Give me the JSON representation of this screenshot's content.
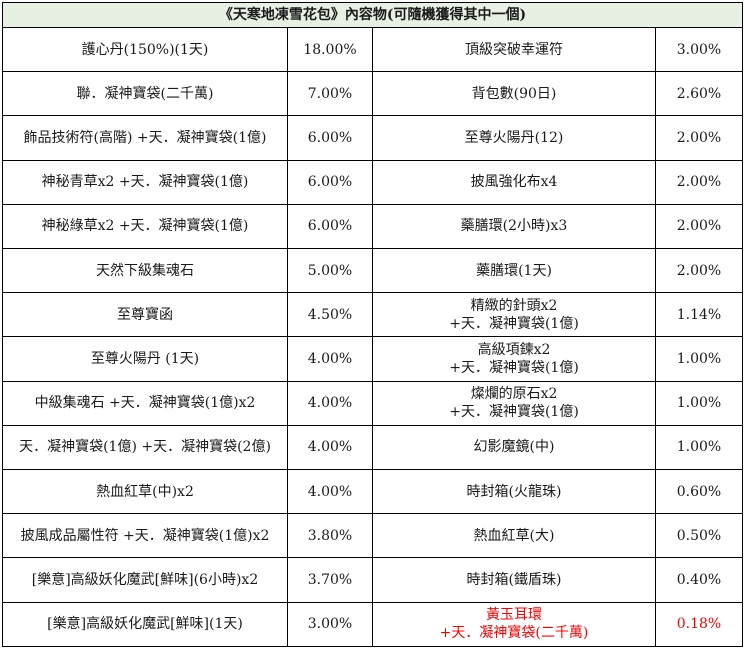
{
  "title": "《天寒地凍雪花包》內容物(可隨機獲得其中一個)",
  "colors": {
    "header_bg": "#e7f0e3",
    "highlight": "#ff0000",
    "border": "#000000"
  },
  "rows": [
    {
      "left_item": [
        "護心丹(150%)(1天)"
      ],
      "left_pct": "18.00%",
      "right_item": [
        "頂級突破幸運符"
      ],
      "right_pct": "3.00%"
    },
    {
      "left_item": [
        "聯．凝神寶袋(二千萬)"
      ],
      "left_pct": "7.00%",
      "right_item": [
        "背包數(90日)"
      ],
      "right_pct": "2.60%"
    },
    {
      "left_item": [
        "飾品技術符(高階) +天．凝神寶袋(1億)"
      ],
      "left_pct": "6.00%",
      "right_item": [
        "至尊火陽丹(12)"
      ],
      "right_pct": "2.00%"
    },
    {
      "left_item": [
        "神秘青草x2 +天．凝神寶袋(1億)"
      ],
      "left_pct": "6.00%",
      "right_item": [
        "披風強化布x4"
      ],
      "right_pct": "2.00%"
    },
    {
      "left_item": [
        "神秘綠草x2 +天．凝神寶袋(1億)"
      ],
      "left_pct": "6.00%",
      "right_item": [
        "藥膳環(2小時)x3"
      ],
      "right_pct": "2.00%"
    },
    {
      "left_item": [
        "天然下級集魂石"
      ],
      "left_pct": "5.00%",
      "right_item": [
        "藥膳環(1天)"
      ],
      "right_pct": "2.00%"
    },
    {
      "left_item": [
        "至尊寶函"
      ],
      "left_pct": "4.50%",
      "right_item": [
        "精緻的針頭x2",
        "+天．凝神寶袋(1億)"
      ],
      "right_pct": "1.14%"
    },
    {
      "left_item": [
        "至尊火陽丹 (1天)"
      ],
      "left_pct": "4.00%",
      "right_item": [
        "高級項鍊x2",
        "+天．凝神寶袋(1億)"
      ],
      "right_pct": "1.00%"
    },
    {
      "left_item": [
        "中級集魂石 +天．凝神寶袋(1億)x2"
      ],
      "left_pct": "4.00%",
      "right_item": [
        "燦爛的原石x2",
        "+天．凝神寶袋(1億)"
      ],
      "right_pct": "1.00%"
    },
    {
      "left_item": [
        "天．凝神寶袋(1億) +天．凝神寶袋(2億)"
      ],
      "left_pct": "4.00%",
      "right_item": [
        "幻影魔鏡(中)"
      ],
      "right_pct": "1.00%"
    },
    {
      "left_item": [
        "熱血紅草(中)x2"
      ],
      "left_pct": "4.00%",
      "right_item": [
        "時封箱(火龍珠)"
      ],
      "right_pct": "0.60%"
    },
    {
      "left_item": [
        "披風成品屬性符 +天．凝神寶袋(1億)x2"
      ],
      "left_pct": "3.80%",
      "right_item": [
        "熱血紅草(大)"
      ],
      "right_pct": "0.50%"
    },
    {
      "left_item": [
        "[樂意]高級妖化魔武[鮮味](6小時)x2"
      ],
      "left_pct": "3.70%",
      "right_item": [
        "時封箱(鐵盾珠)"
      ],
      "right_pct": "0.40%"
    },
    {
      "left_item": [
        "[樂意]高級妖化魔武[鮮味](1天)"
      ],
      "left_pct": "3.00%",
      "right_item": [
        "黃玉耳環",
        "+天．凝神寶袋(二千萬)"
      ],
      "right_pct": "0.18%",
      "highlight_right": true
    }
  ]
}
